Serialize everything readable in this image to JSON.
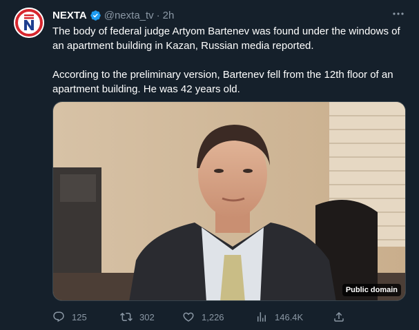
{
  "tweet": {
    "author_name": "NEXTA",
    "handle": "@nexta_tv",
    "separator": "·",
    "time": "2h",
    "paragraphs": [
      "The body of federal judge Artyom Bartenev was found under the windows of an apartment building in Kazan, Russian media reported.",
      "According to the preliminary version, Bartenev fell from the 12th floor of an apartment building. He was 42 years old."
    ],
    "media_badge": "Public domain"
  },
  "actions": {
    "replies": "125",
    "retweets": "302",
    "likes": "1,226",
    "views": "146.4K"
  },
  "colors": {
    "background": "#15202b",
    "text": "#ffffff",
    "muted": "#8b98a5",
    "verified": "#1d9bf0",
    "brand_red": "#d7262e"
  },
  "icons": [
    "nexta-logo",
    "verified-badge-icon",
    "more-icon",
    "reply-icon",
    "retweet-icon",
    "like-icon",
    "views-icon",
    "share-icon"
  ]
}
